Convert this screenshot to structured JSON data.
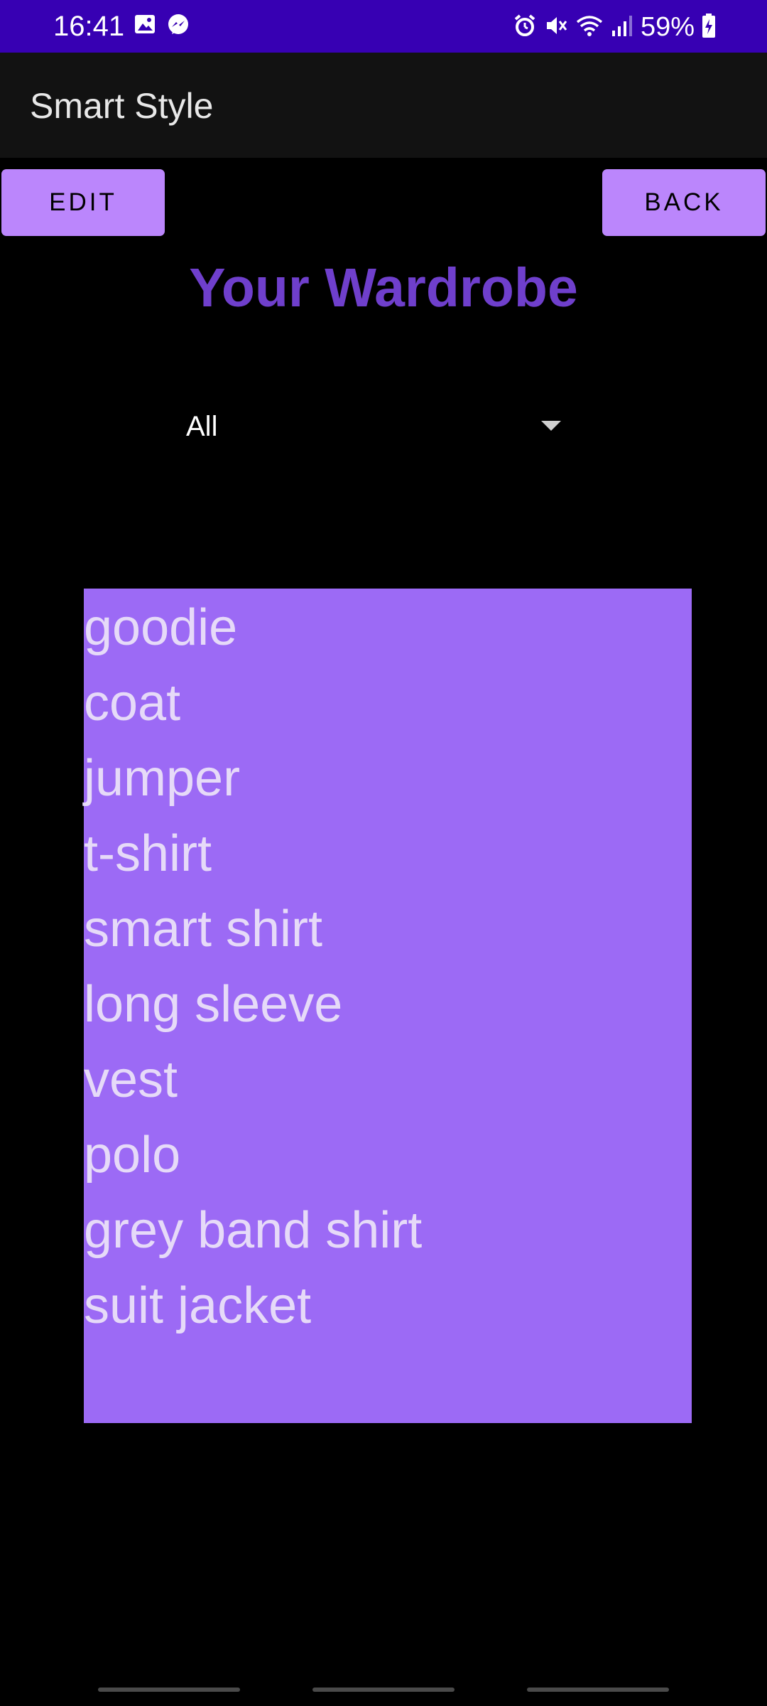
{
  "status_bar": {
    "time": "16:41",
    "battery": "59%",
    "icons_left": [
      "image-icon",
      "messenger-icon"
    ],
    "icons_right": [
      "alarm-icon",
      "mute-icon",
      "wifi-icon",
      "signal-icon",
      "battery-charging-icon"
    ],
    "color": "#3700B3"
  },
  "app_bar": {
    "title": "Smart Style"
  },
  "buttons": {
    "edit_label": "EDIT",
    "back_label": "BACK",
    "color": "#BB86FC"
  },
  "page": {
    "title": "Your Wardrobe",
    "title_color": "#6F3FCC"
  },
  "filter": {
    "selected": "All"
  },
  "wardrobe": {
    "items": [
      "goodie",
      "coat",
      "jumper",
      "t-shirt",
      "smart shirt",
      "long sleeve",
      "vest",
      "polo",
      "grey band shirt",
      "suit jacket"
    ],
    "background": "#9C6AF5"
  }
}
